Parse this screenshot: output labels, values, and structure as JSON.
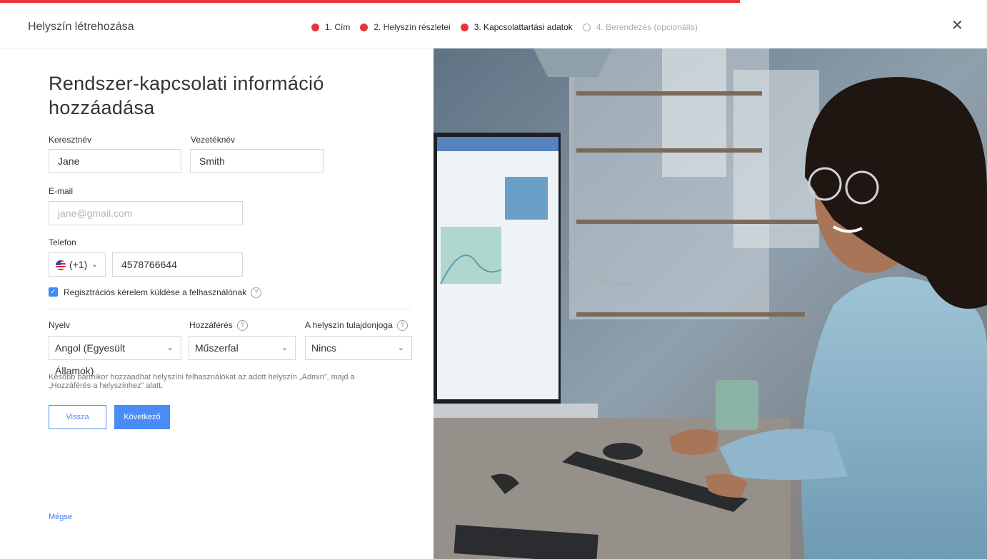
{
  "header": {
    "title": "Helyszín létrehozása",
    "steps": [
      {
        "label": "1. Cím",
        "state": "done"
      },
      {
        "label": "2. Helyszín részletei",
        "state": "done"
      },
      {
        "label": "3. Kapcsolattartási adatok",
        "state": "current"
      },
      {
        "label": "4. Berendezés (opcionális)",
        "state": "inactive"
      }
    ],
    "close_icon": "close-icon",
    "progress_fraction": 0.75
  },
  "form": {
    "heading": "Rendszer-kapcsolati információ hozzáadása",
    "first_name_label": "Keresztnév",
    "first_name_value": "Jane",
    "last_name_label": "Vezetéknév",
    "last_name_value": "Smith",
    "email_label": "E-mail",
    "email_placeholder": "jane@gmail.com",
    "phone_label": "Telefon",
    "phone_code": "(+1)",
    "phone_value": "4578766644",
    "checkbox_label": "Regisztrációs kérelem küldése a felhasználónak",
    "checkbox_checked": true,
    "language_label": "Nyelv",
    "language_value": "Angol (Egyesült Államok)",
    "access_label": "Hozzáférés",
    "access_value": "Műszerfal",
    "ownership_label": "A helyszín tulajdonjoga",
    "ownership_value": "Nincs",
    "note": "Később bármikor hozzáadhat helyszíni felhasználókat az adott helyszín „Admin”, majd a „Hozzáférés a helyszínhez” alatt.",
    "back_label": "Vissza",
    "next_label": "Következő",
    "cancel_label": "Mégse"
  },
  "colors": {
    "accent_red": "#e8343b",
    "primary_blue": "#4a8cf6"
  }
}
